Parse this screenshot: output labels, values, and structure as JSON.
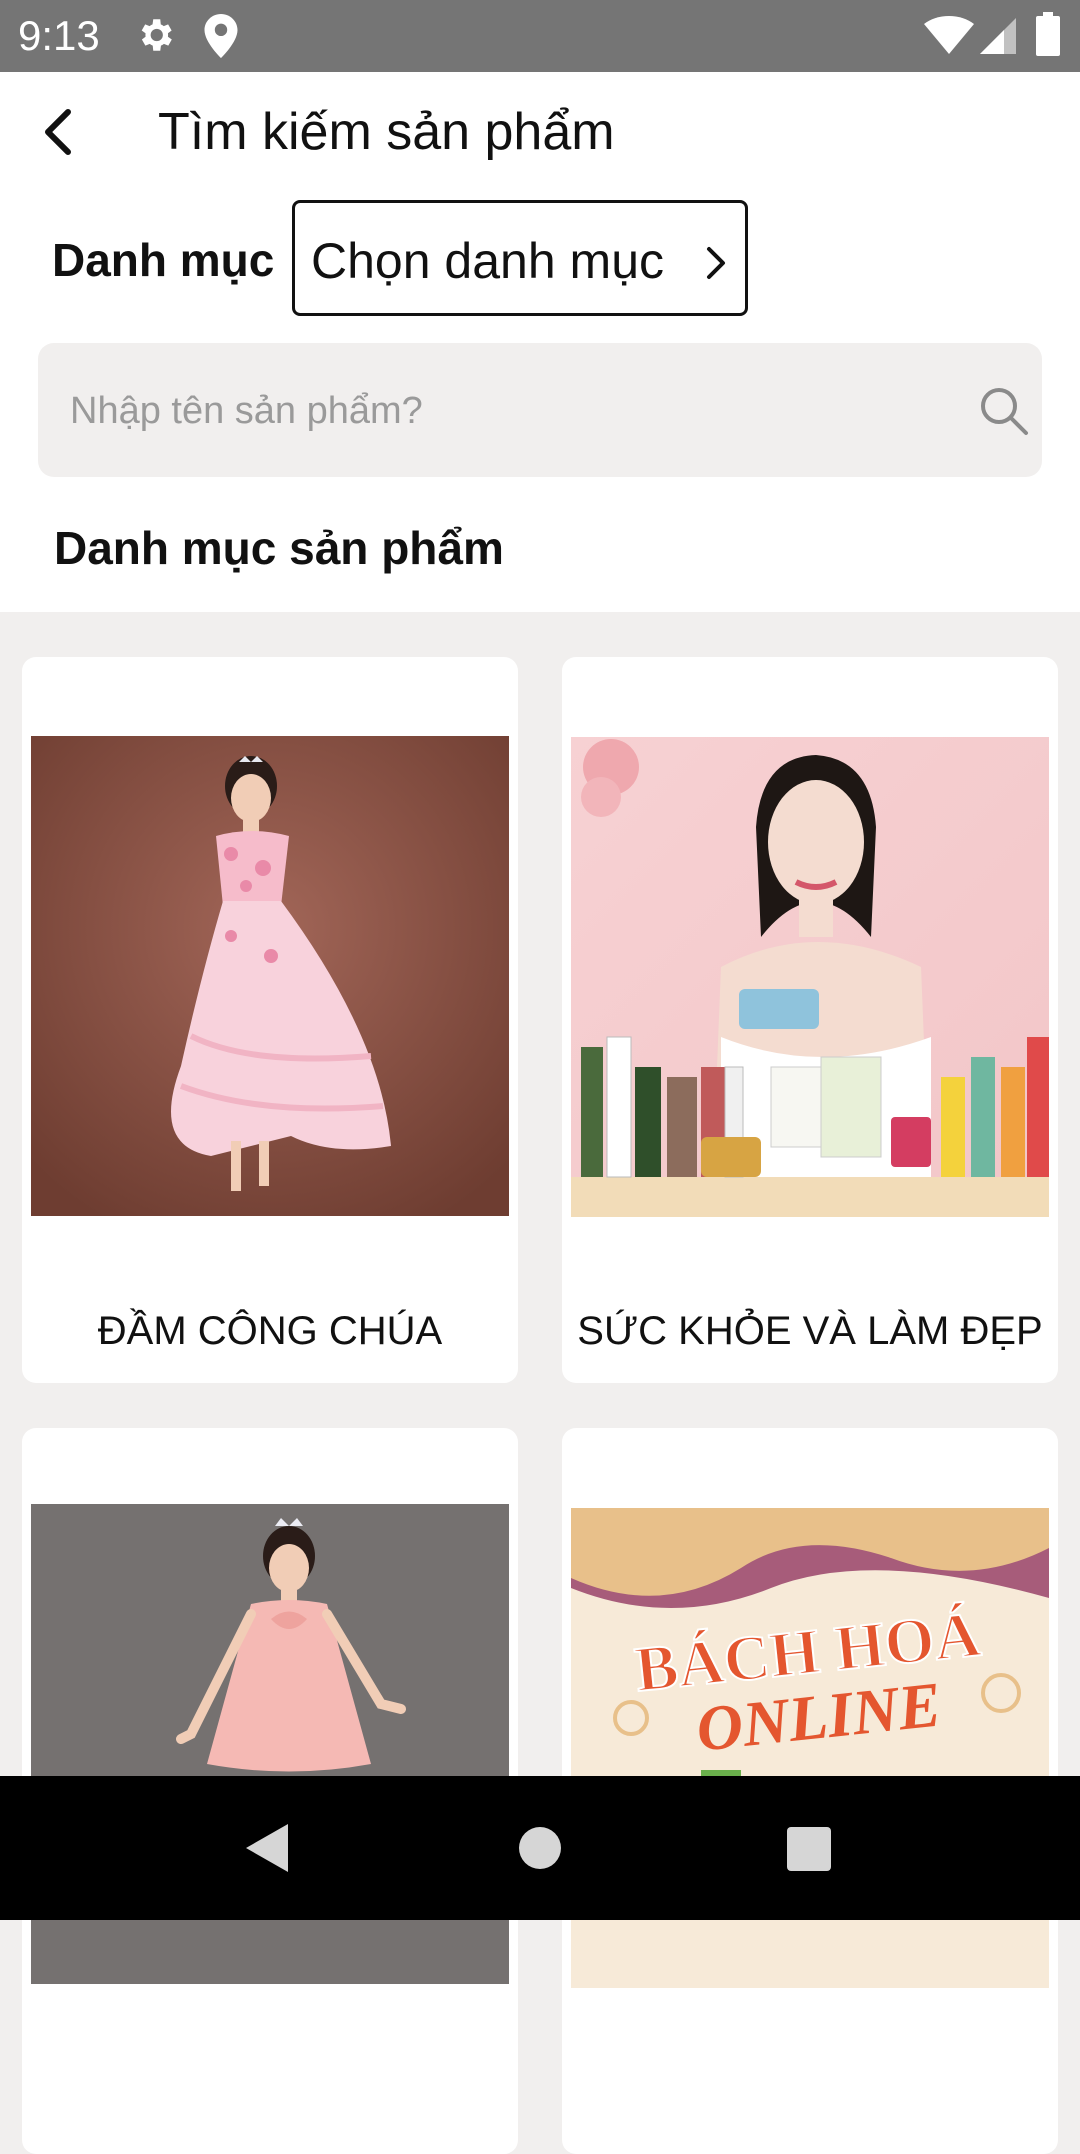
{
  "status_bar": {
    "time": "9:13",
    "icons": [
      "gear-icon",
      "location-pin-icon",
      "wifi-icon",
      "signal-icon",
      "battery-icon"
    ]
  },
  "header": {
    "title": "Tìm kiếm sản phẩm",
    "back_icon": "chevron-left-icon"
  },
  "filter": {
    "label": "Danh mục",
    "picker_label": "Chọn danh mục",
    "picker_icon": "chevron-right-icon"
  },
  "search": {
    "value": "",
    "placeholder": "Nhập tên sản phẩm?",
    "icon": "search-icon"
  },
  "section": {
    "title": "Danh mục sản phẩm"
  },
  "categories": [
    {
      "label": "ĐẦM CÔNG CHÚA"
    },
    {
      "label": "SỨC KHỎE VÀ LÀM ĐẸP"
    },
    {
      "label": ""
    },
    {
      "label": "",
      "image_text_1": "BÁCH HOÁ",
      "image_text_2": "ONLINE"
    }
  ],
  "nav_bar": {
    "icons": [
      "back-triangle-icon",
      "home-circle-icon",
      "recents-square-icon"
    ]
  },
  "colors": {
    "status_bar": "#757575",
    "background": "#f1efee",
    "card": "#ffffff",
    "text": "#111111",
    "placeholder": "#9a9a9a",
    "nav_bar": "#000000"
  }
}
